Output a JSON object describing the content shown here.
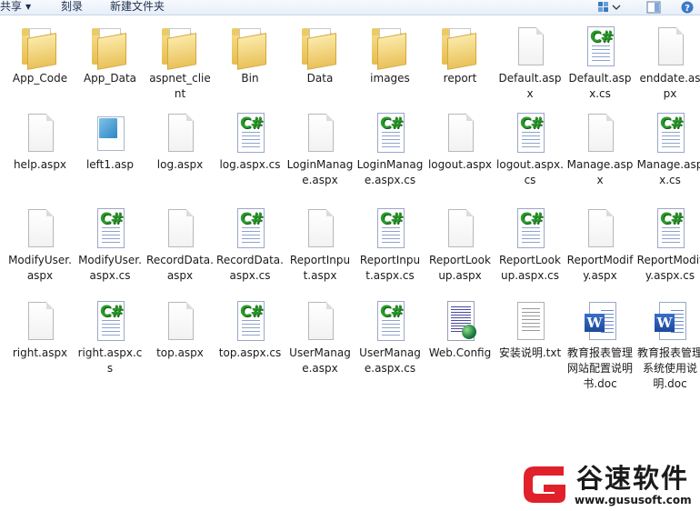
{
  "toolbar": {
    "share_label": "共享",
    "share_arrow": "▼",
    "burn_label": "刻录",
    "new_folder_label": "新建文件夹",
    "view_icon": "view-options-icon",
    "preview_icon": "preview-pane-icon",
    "help_icon": "help-icon"
  },
  "files": [
    {
      "name": "App_Code",
      "type": "folder"
    },
    {
      "name": "App_Data",
      "type": "folder"
    },
    {
      "name": "aspnet_client",
      "type": "folder"
    },
    {
      "name": "Bin",
      "type": "folder"
    },
    {
      "name": "Data",
      "type": "folder"
    },
    {
      "name": "images",
      "type": "folder"
    },
    {
      "name": "report",
      "type": "folder"
    },
    {
      "name": "Default.aspx",
      "type": "doc"
    },
    {
      "name": "Default.aspx.cs",
      "type": "cs"
    },
    {
      "name": "enddate.aspx",
      "type": "doc"
    },
    {
      "name": "help.aspx",
      "type": "doc"
    },
    {
      "name": "left1.asp",
      "type": "asp"
    },
    {
      "name": "log.aspx",
      "type": "doc"
    },
    {
      "name": "log.aspx.cs",
      "type": "cs"
    },
    {
      "name": "LoginManage.aspx",
      "type": "doc"
    },
    {
      "name": "LoginManage.aspx.cs",
      "type": "cs"
    },
    {
      "name": "logout.aspx",
      "type": "doc"
    },
    {
      "name": "logout.aspx.cs",
      "type": "cs"
    },
    {
      "name": "Manage.aspx",
      "type": "doc"
    },
    {
      "name": "Manage.aspx.cs",
      "type": "cs"
    },
    {
      "name": "ModifyUser.aspx",
      "type": "doc"
    },
    {
      "name": "ModifyUser.aspx.cs",
      "type": "cs"
    },
    {
      "name": "RecordData.aspx",
      "type": "doc"
    },
    {
      "name": "RecordData.aspx.cs",
      "type": "cs"
    },
    {
      "name": "ReportInput.aspx",
      "type": "doc"
    },
    {
      "name": "ReportInput.aspx.cs",
      "type": "cs"
    },
    {
      "name": "ReportLookup.aspx",
      "type": "doc"
    },
    {
      "name": "ReportLookup.aspx.cs",
      "type": "cs"
    },
    {
      "name": "ReportModify.aspx",
      "type": "doc"
    },
    {
      "name": "ReportModify.aspx.cs",
      "type": "cs"
    },
    {
      "name": "right.aspx",
      "type": "doc"
    },
    {
      "name": "right.aspx.cs",
      "type": "cs"
    },
    {
      "name": "top.aspx",
      "type": "doc"
    },
    {
      "name": "top.aspx.cs",
      "type": "cs"
    },
    {
      "name": "UserManage.aspx",
      "type": "doc"
    },
    {
      "name": "UserManage.aspx.cs",
      "type": "cs"
    },
    {
      "name": "Web.Config",
      "type": "cfg"
    },
    {
      "name": "安装说明.txt",
      "type": "txt"
    },
    {
      "name": "教育报表管理网站配置说明书.doc",
      "type": "word"
    },
    {
      "name": "教育报表管理系统使用说明.doc",
      "type": "word"
    }
  ],
  "watermark": {
    "name": "谷速软件",
    "url": "www.gususoft.com",
    "logo_color": "#e0202a"
  }
}
